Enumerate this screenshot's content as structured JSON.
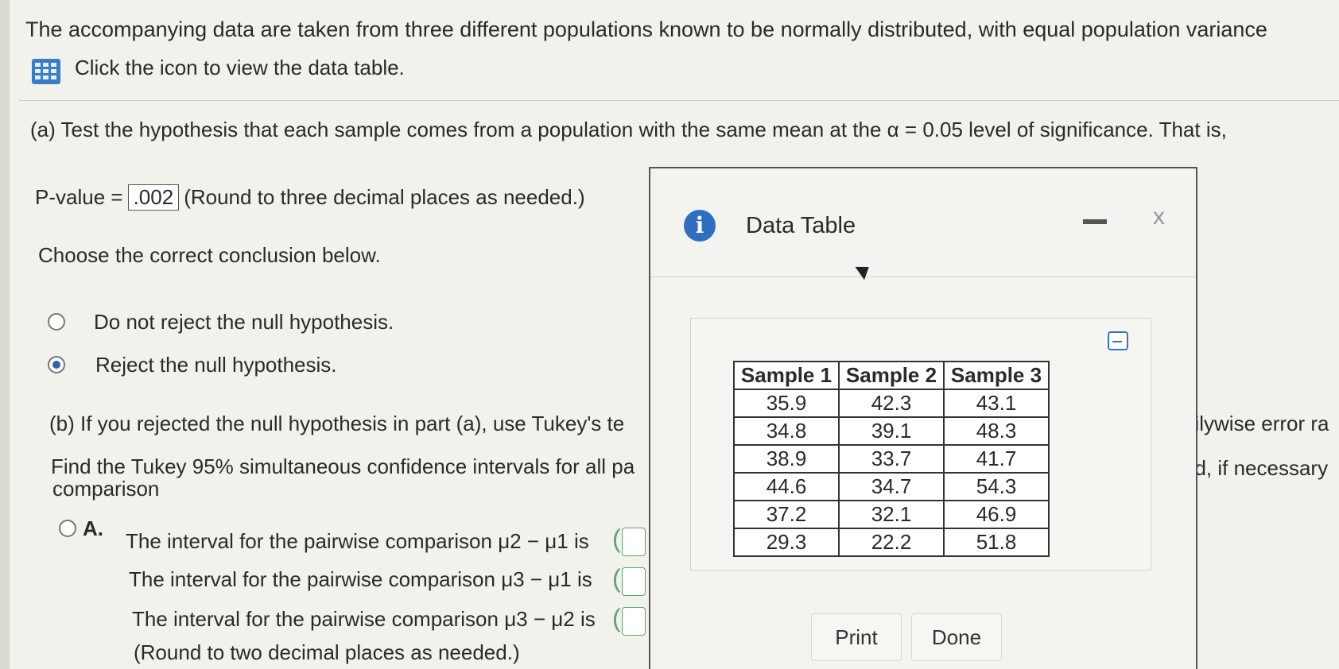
{
  "intro": "The accompanying data are taken from three different populations known to be normally distributed, with equal population variance",
  "data_table_link": "Click the icon to view the data table.",
  "part_a": {
    "prompt": "(a) Test the hypothesis that each sample comes from a population with the same mean at the α = 0.05 level of significance. That is,",
    "pvalue_label": "P-value =",
    "pvalue_value": ".002",
    "pvalue_hint": "(Round to three decimal places as needed.)",
    "conclusion_prompt": "Choose the correct conclusion below.",
    "options": [
      "Do not reject the null hypothesis.",
      "Reject the null hypothesis."
    ]
  },
  "part_b": {
    "prompt": "(b) If you rejected the null hypothesis in part (a), use Tukey's te",
    "prompt_right": "hilywise error ra",
    "find": "Find the Tukey 95% simultaneous confidence intervals for all pa",
    "find_right": "nd, if necessary",
    "find_cont": "comparison",
    "option_letter": "A.",
    "intervals": [
      "The interval for the pairwise comparison μ2 − μ1 is",
      "The interval for the pairwise comparison μ3 − μ1 is",
      "The interval for the pairwise comparison μ3 − μ2 is"
    ],
    "round_hint": "(Round to two decimal places as needed.)"
  },
  "dialog": {
    "title": "Data Table",
    "close": "x",
    "headers": [
      "Sample 1",
      "Sample 2",
      "Sample 3"
    ],
    "rows": [
      [
        "35.9",
        "42.3",
        "43.1"
      ],
      [
        "34.8",
        "39.1",
        "48.3"
      ],
      [
        "38.9",
        "33.7",
        "41.7"
      ],
      [
        "44.6",
        "34.7",
        "54.3"
      ],
      [
        "37.2",
        "32.1",
        "46.9"
      ],
      [
        "29.3",
        "22.2",
        "51.8"
      ]
    ],
    "print": "Print",
    "done": "Done"
  }
}
